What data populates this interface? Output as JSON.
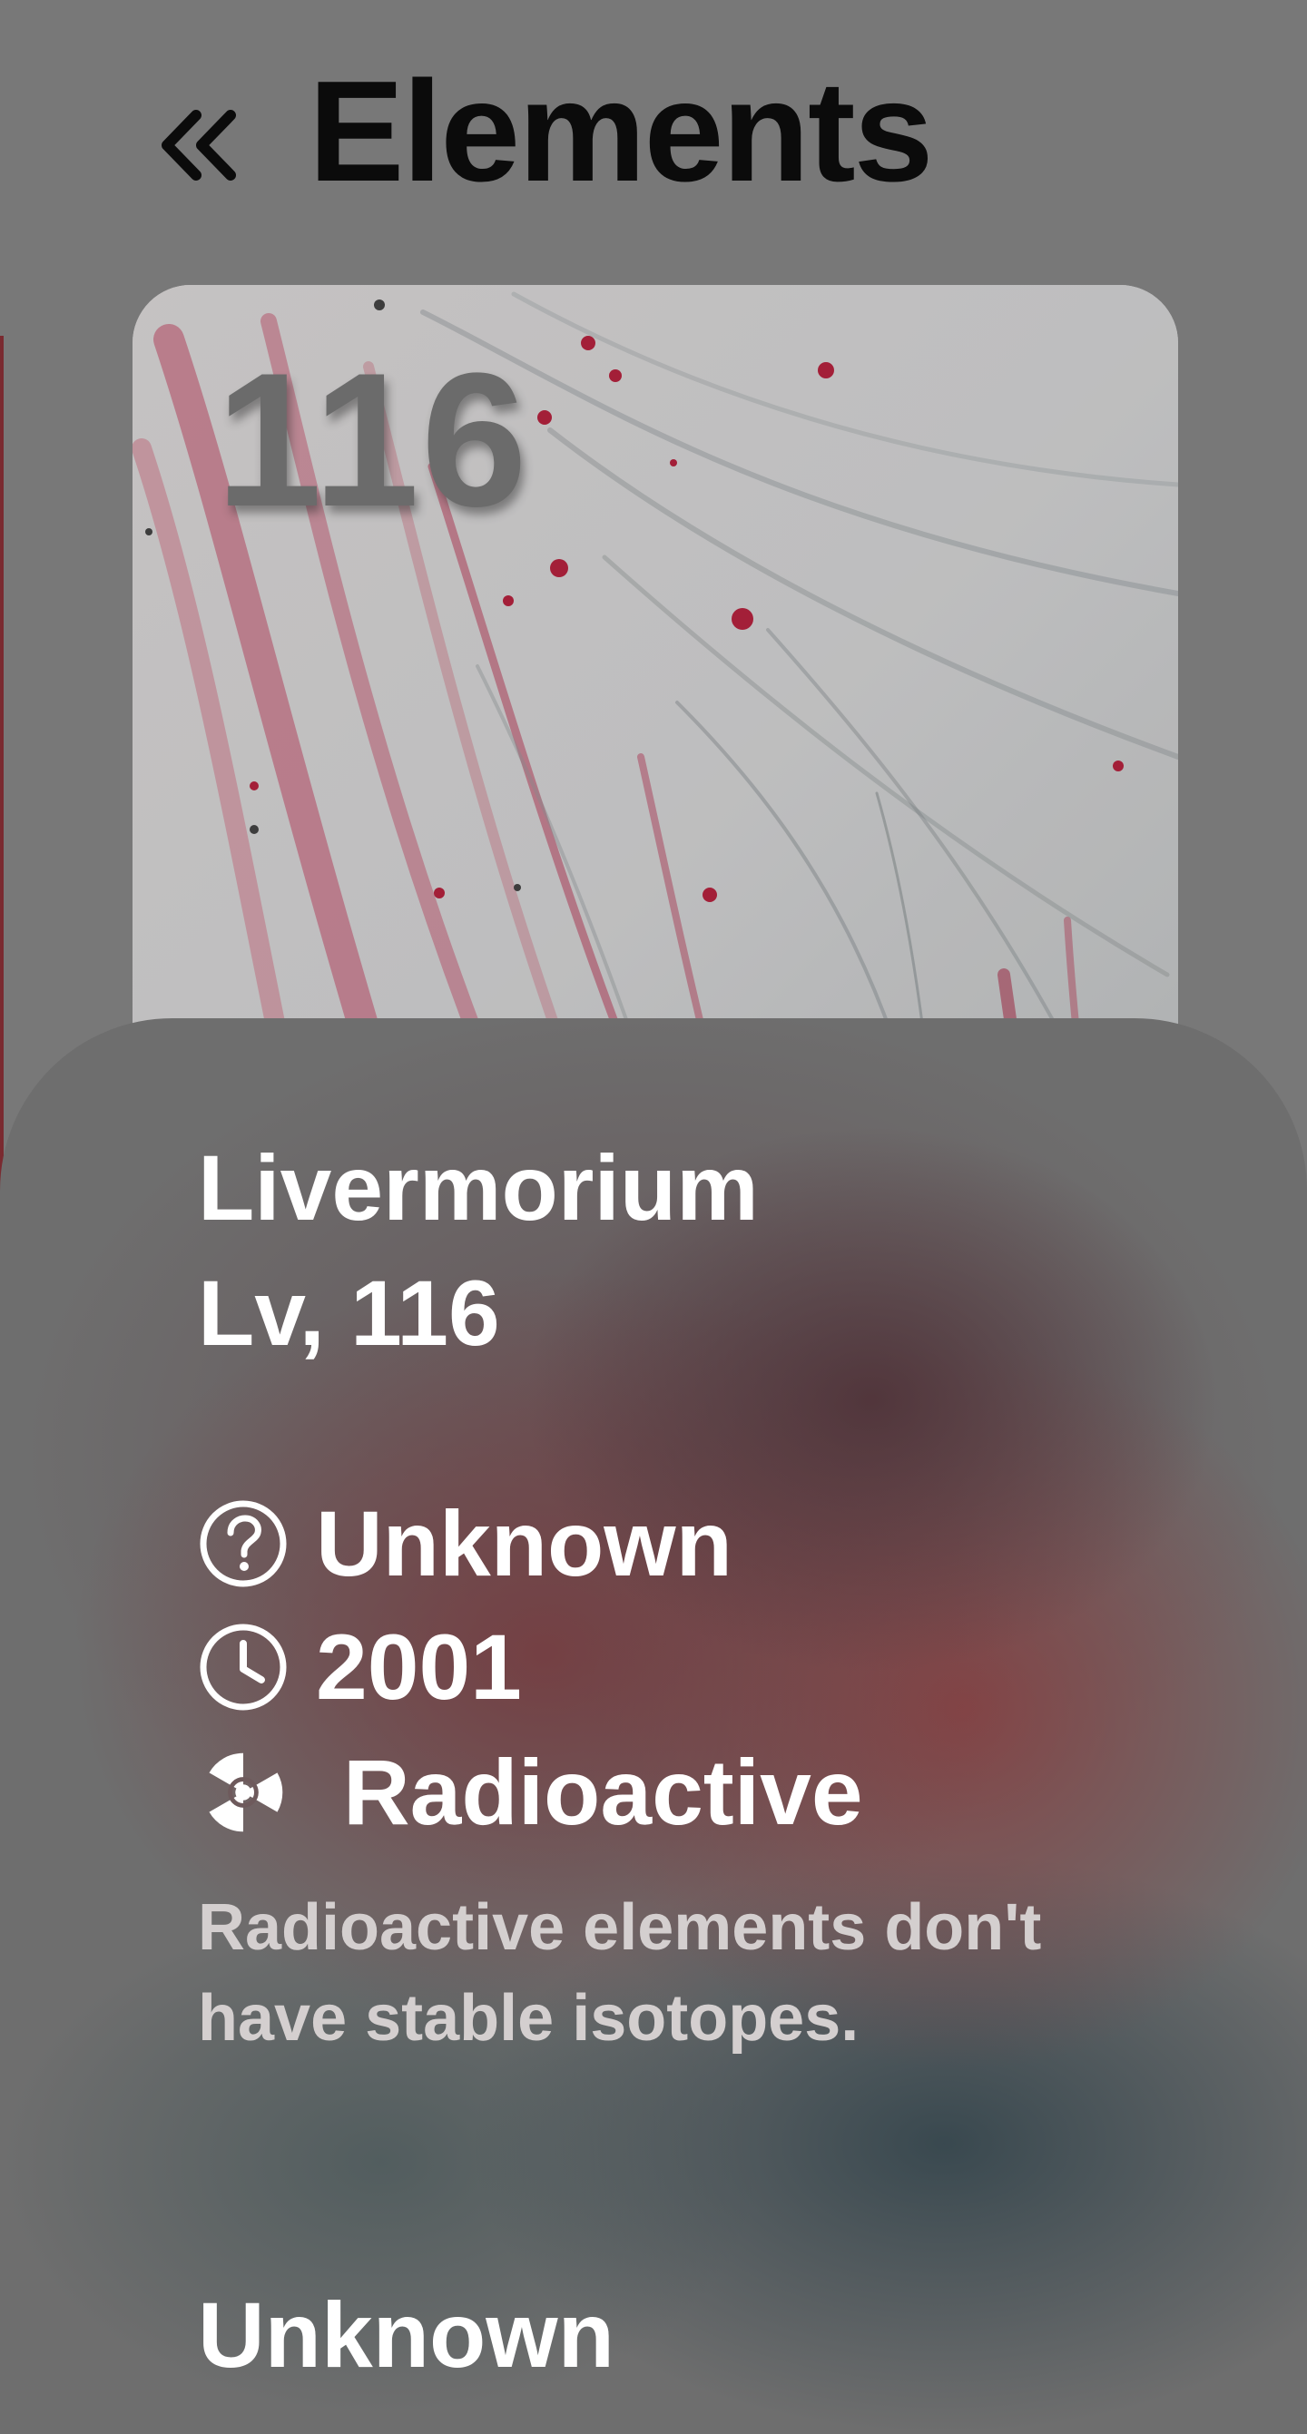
{
  "header": {
    "title": "Elements",
    "back_icon": "double-chevron-left-icon"
  },
  "hero": {
    "atomic_number": "116",
    "background": "red-gray-marbled-ink-image"
  },
  "element": {
    "name": "Livermorium",
    "symbol_line": "Lv, 116",
    "facts": {
      "state": {
        "icon": "question-circle-icon",
        "text": "Unknown"
      },
      "discovered": {
        "icon": "clock-icon",
        "text": "2001"
      },
      "category": {
        "icon": "radioactive-icon",
        "text": "Radioactive"
      }
    },
    "category_description": "Radioactive elements don't have stable isotopes.",
    "next_section_heading": "Unknown"
  },
  "colors": {
    "screen_dim": "#787878",
    "title_text": "#0b0b0b",
    "sheet_text": "#ffffff",
    "description_text": "#d4cfcf",
    "accent_red": "#c0243a"
  }
}
